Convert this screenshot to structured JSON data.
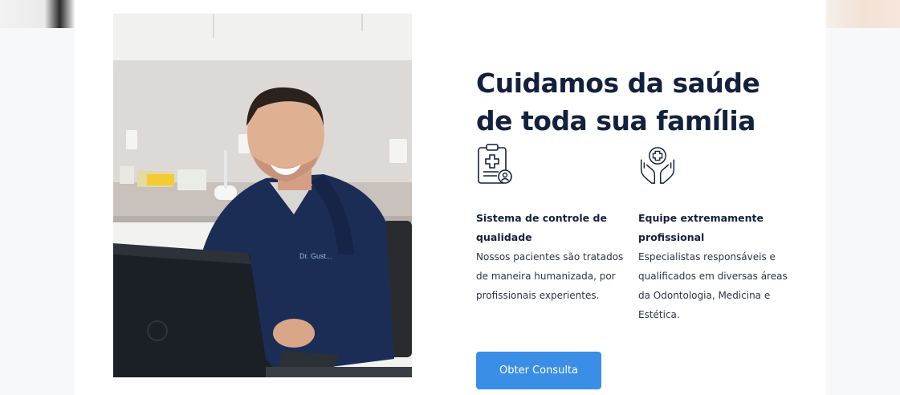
{
  "headline": {
    "line1": "Cuidamos da saúde",
    "line2": "de toda sua família"
  },
  "features": [
    {
      "icon": "clipboard-medical-icon",
      "title": "Sistema de controle de qualidade",
      "text": "Nossos pacientes são tratados de maneira humanizada, por profissionais experientes."
    },
    {
      "icon": "hands-medical-cross-icon",
      "title": "Equipe extremamente profissional",
      "text": "Especialistas responsáveis e qualificados em diversas áreas da Odontologia, Medicina e Estética."
    }
  ],
  "cta": {
    "label": "Obter Consulta"
  },
  "colors": {
    "heading": "#14213d",
    "body_text": "#2d3448",
    "button": "#3a8ee6",
    "card": "#ffffff",
    "background": "#f7f8fa"
  },
  "photo": {
    "description_icon": "doctor-photo",
    "coat_badge": "Dr. Gust..."
  }
}
